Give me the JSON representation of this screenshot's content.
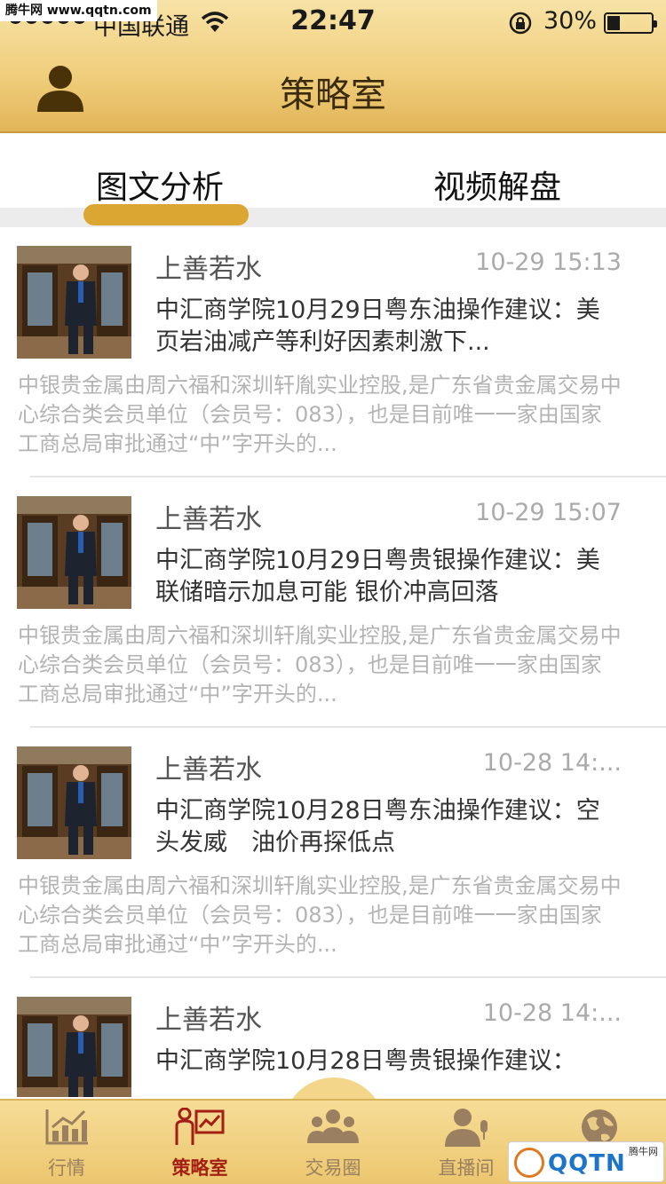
{
  "watermark_top": "腾牛网 www.qqtn.com",
  "status_bar": {
    "carrier": "中国联通",
    "time": "22:47",
    "battery_pct": "30%",
    "battery_level": 0.3
  },
  "header": {
    "title": "策略室",
    "avatar_icon": "user-icon"
  },
  "tabs": [
    {
      "label": "图文分析",
      "active": true
    },
    {
      "label": "视频解盘",
      "active": false
    }
  ],
  "articles": [
    {
      "author": "上善若水",
      "time": "10-29 15:13",
      "headline": "中汇商学院10月29日粤东油操作建议：美页岩油减产等利好因素刺激下...",
      "summary": "中银贵金属由周六福和深圳轩胤实业控股,是广东省贵金属交易中心综合类会员单位（会员号：083），也是目前唯一一家由国家工商总局审批通过“中”字开头的..."
    },
    {
      "author": "上善若水",
      "time": "10-29 15:07",
      "headline": "中汇商学院10月29日粤贵银操作建议：美联储暗示加息可能 银价冲高回落",
      "summary": "中银贵金属由周六福和深圳轩胤实业控股,是广东省贵金属交易中心综合类会员单位（会员号：083），也是目前唯一一家由国家工商总局审批通过“中”字开头的..."
    },
    {
      "author": "上善若水",
      "time": "10-28 14:...",
      "headline": "中汇商学院10月28日粤东油操作建议：空头发威　油价再探低点",
      "summary": "中银贵金属由周六福和深圳轩胤实业控股,是广东省贵金属交易中心综合类会员单位（会员号：083），也是目前唯一一家由国家工商总局审批通过“中”字开头的..."
    },
    {
      "author": "上善若水",
      "time": "10-28 14:...",
      "headline": "中汇商学院10月28日粤贵银操作建议：",
      "summary": ""
    }
  ],
  "tabbar": [
    {
      "label": "行情",
      "icon": "chart-icon",
      "active": false
    },
    {
      "label": "策略室",
      "icon": "presenter-icon",
      "active": true
    },
    {
      "label": "交易圈",
      "icon": "group-icon",
      "active": false
    },
    {
      "label": "直播间",
      "icon": "broadcaster-icon",
      "active": false
    },
    {
      "label": "",
      "icon": "globe-icon",
      "active": false
    }
  ],
  "watermark_bottom": {
    "brand": "QQTN",
    "site": "腾牛网"
  },
  "colors": {
    "header_gold": "#f0cf7e",
    "tab_indicator": "#dba632",
    "tab_active_text": "#a31e13",
    "tab_inactive_text": "#9a8060"
  }
}
